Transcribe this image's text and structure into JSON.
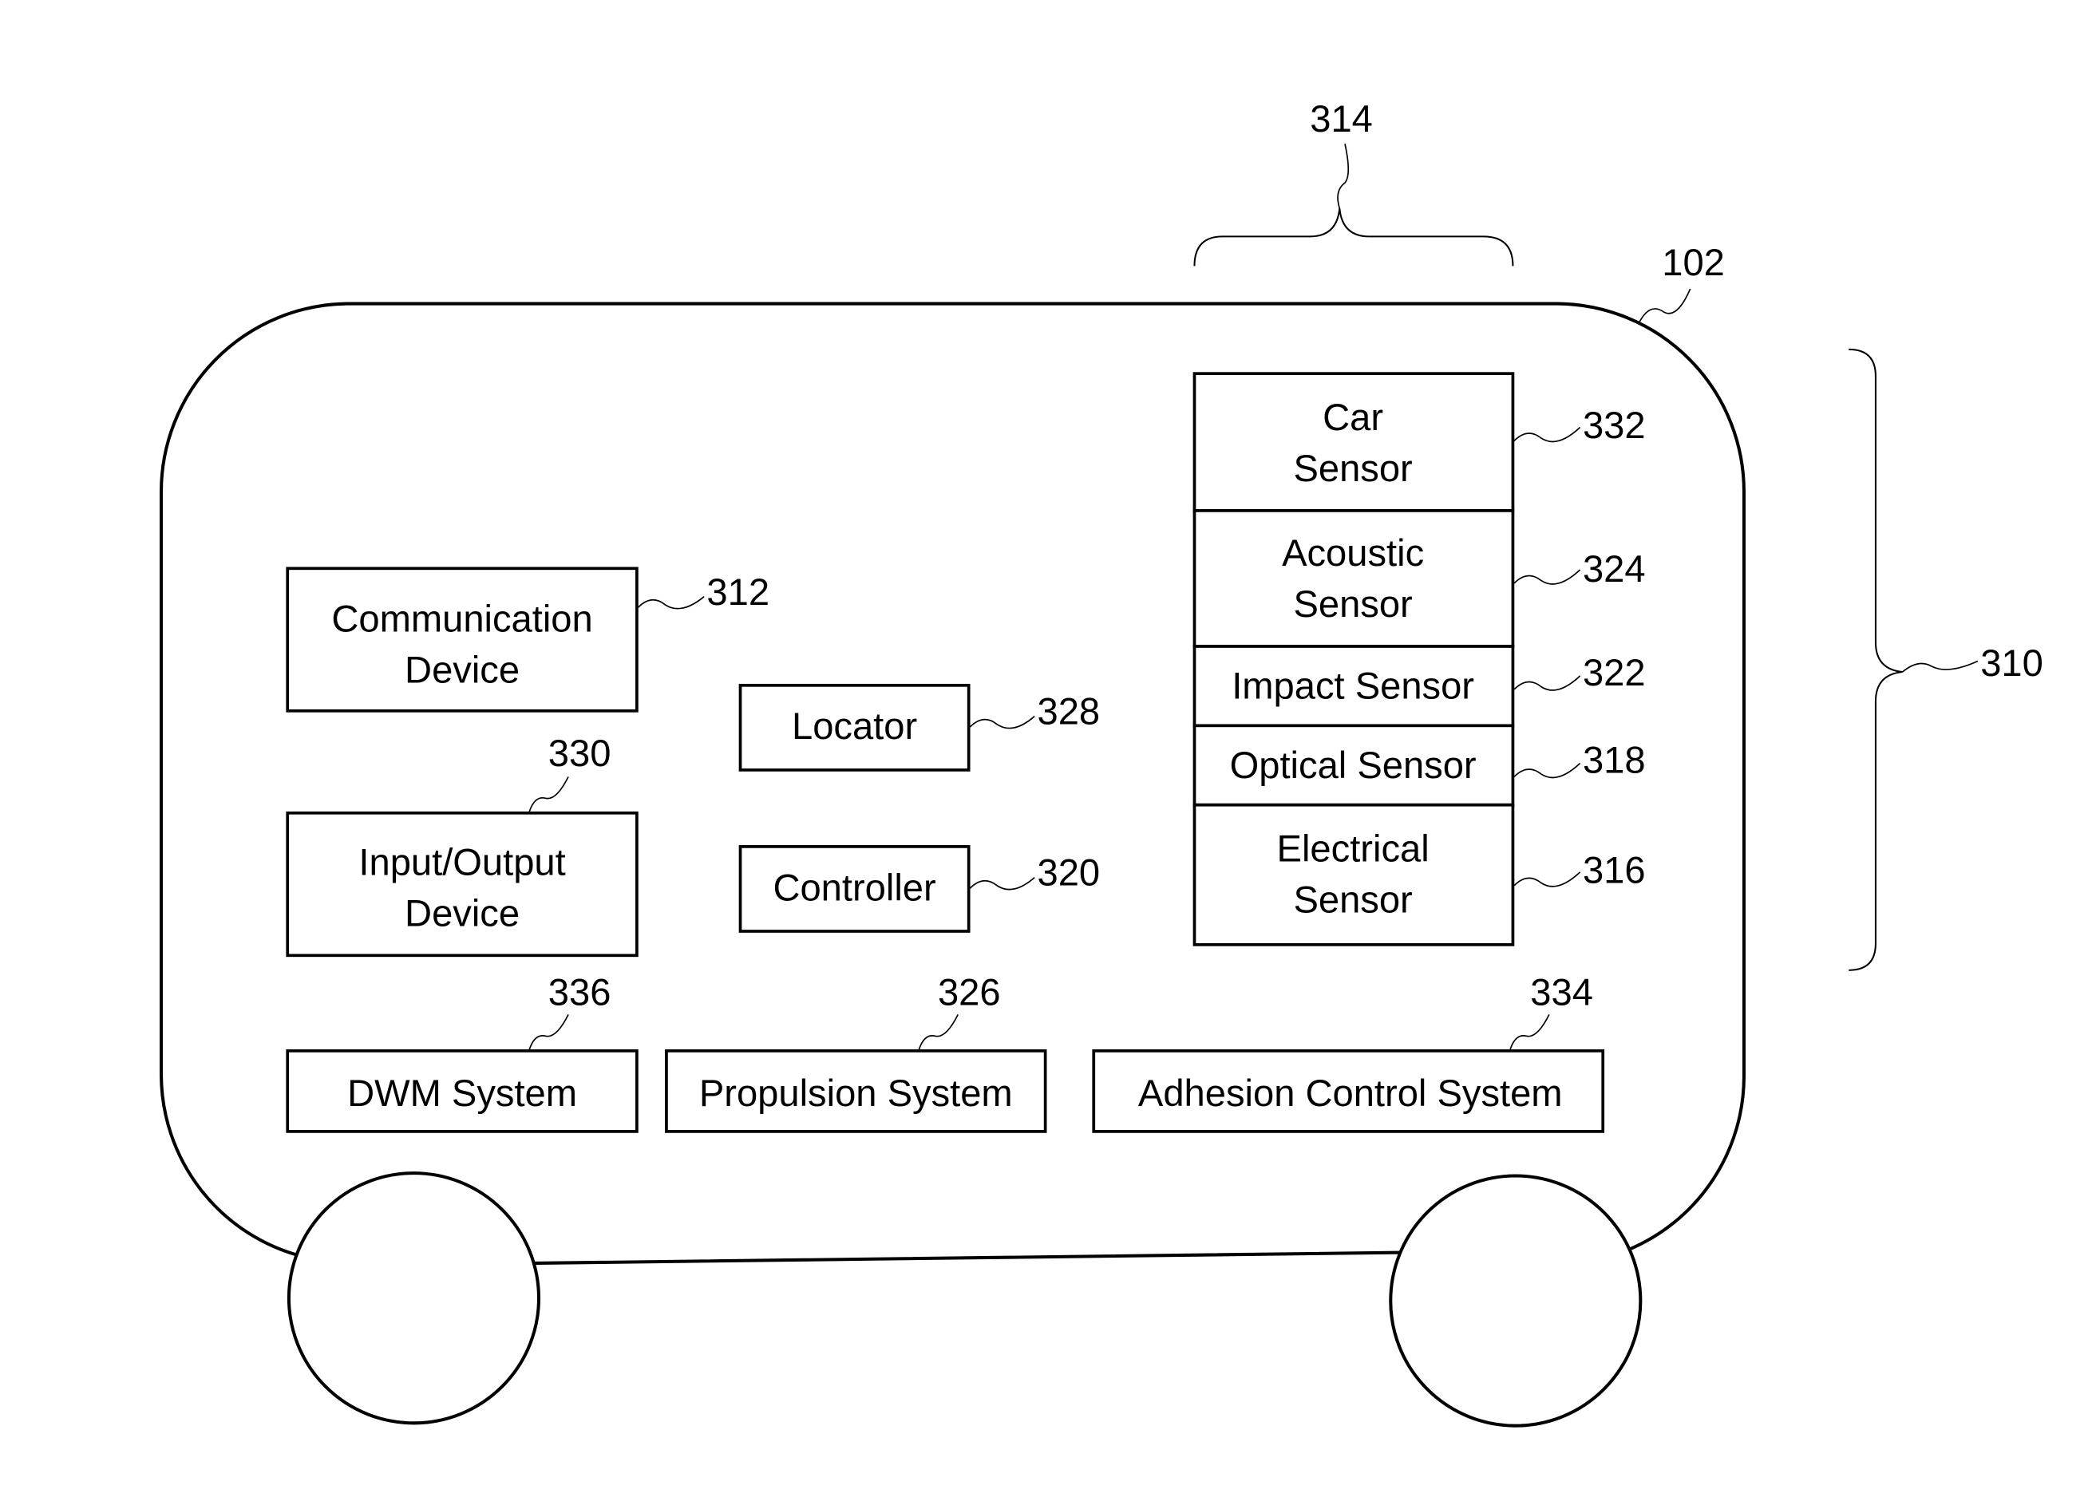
{
  "figure": {
    "vehicle_ref": "102",
    "group_refs": {
      "sensor_group_top": "314",
      "sensor_group_side": "310"
    },
    "components": [
      {
        "id": "communication-device",
        "lines": [
          "Communication",
          "Device"
        ],
        "ref": "312"
      },
      {
        "id": "input-output-device",
        "lines": [
          "Input/Output",
          "Device"
        ],
        "ref": "330"
      },
      {
        "id": "locator",
        "lines": [
          "Locator"
        ],
        "ref": "328"
      },
      {
        "id": "controller",
        "lines": [
          "Controller"
        ],
        "ref": "320"
      },
      {
        "id": "dwm-system",
        "lines": [
          "DWM System"
        ],
        "ref": "336"
      },
      {
        "id": "propulsion-system",
        "lines": [
          "Propulsion System"
        ],
        "ref": "326"
      },
      {
        "id": "adhesion-control-system",
        "lines": [
          "Adhesion Control System"
        ],
        "ref": "334"
      }
    ],
    "sensors": [
      {
        "id": "car-sensor",
        "lines": [
          "Car",
          "Sensor"
        ],
        "ref": "332"
      },
      {
        "id": "acoustic-sensor",
        "lines": [
          "Acoustic",
          "Sensor"
        ],
        "ref": "324"
      },
      {
        "id": "impact-sensor",
        "lines": [
          "Impact Sensor"
        ],
        "ref": "322"
      },
      {
        "id": "optical-sensor",
        "lines": [
          "Optical Sensor"
        ],
        "ref": "318"
      },
      {
        "id": "electrical-sensor",
        "lines": [
          "Electrical",
          "Sensor"
        ],
        "ref": "316"
      }
    ]
  }
}
